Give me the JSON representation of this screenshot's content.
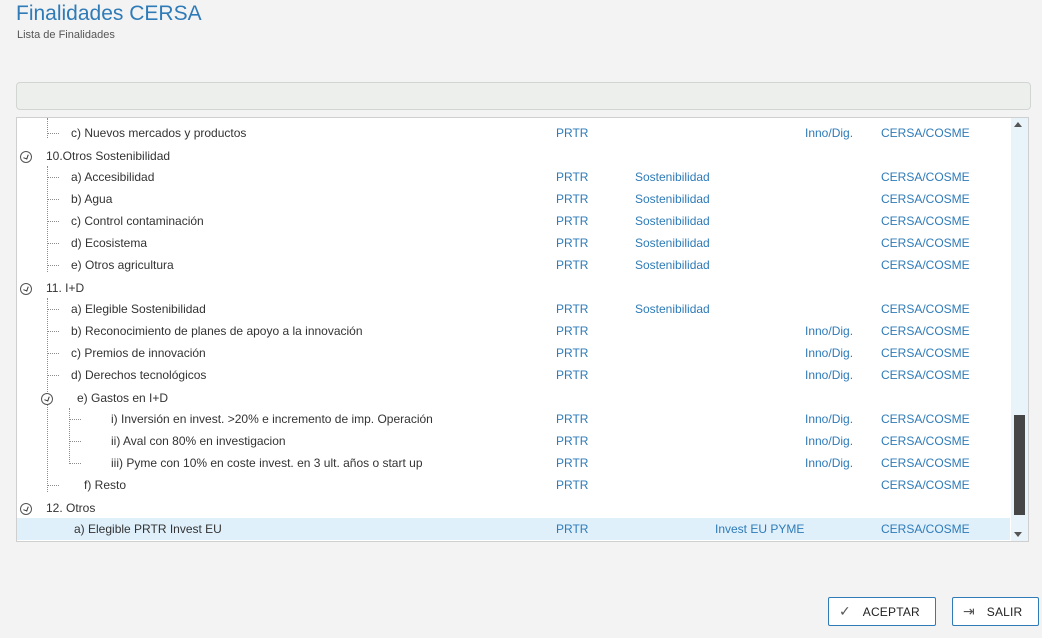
{
  "header": {
    "title": "Finalidades CERSA",
    "subtitle": "Lista de Finalidades"
  },
  "tree": {
    "rows": [
      {
        "label": "c) Nuevos mercados y productos",
        "prtr": "PRTR",
        "sost": "",
        "inno": "Inno/Dig.",
        "org": "CERSA/COSME"
      },
      {
        "label": "10.Otros Sostenibilidad",
        "prtr": "",
        "sost": "",
        "inno": "",
        "org": ""
      },
      {
        "label": "a) Accesibilidad",
        "prtr": "PRTR",
        "sost": "Sostenibilidad",
        "inno": "",
        "org": "CERSA/COSME"
      },
      {
        "label": "b) Agua",
        "prtr": "PRTR",
        "sost": "Sostenibilidad",
        "inno": "",
        "org": "CERSA/COSME"
      },
      {
        "label": "c) Control contaminación",
        "prtr": "PRTR",
        "sost": "Sostenibilidad",
        "inno": "",
        "org": "CERSA/COSME"
      },
      {
        "label": "d) Ecosistema",
        "prtr": "PRTR",
        "sost": "Sostenibilidad",
        "inno": "",
        "org": "CERSA/COSME"
      },
      {
        "label": "e) Otros agricultura",
        "prtr": "PRTR",
        "sost": "Sostenibilidad",
        "inno": "",
        "org": "CERSA/COSME"
      },
      {
        "label": "11. I+D",
        "prtr": "",
        "sost": "",
        "inno": "",
        "org": ""
      },
      {
        "label": "a) Elegible Sostenibilidad",
        "prtr": "PRTR",
        "sost": "Sostenibilidad",
        "inno": "",
        "org": "CERSA/COSME"
      },
      {
        "label": "b) Reconocimiento de planes de apoyo a la innovación",
        "prtr": "PRTR",
        "sost": "",
        "inno": "Inno/Dig.",
        "org": "CERSA/COSME"
      },
      {
        "label": "c) Premios de innovación",
        "prtr": "PRTR",
        "sost": "",
        "inno": "Inno/Dig.",
        "org": "CERSA/COSME"
      },
      {
        "label": "d) Derechos tecnológicos",
        "prtr": "PRTR",
        "sost": "",
        "inno": "Inno/Dig.",
        "org": "CERSA/COSME"
      },
      {
        "label": "e) Gastos en I+D",
        "prtr": "",
        "sost": "",
        "inno": "",
        "org": ""
      },
      {
        "label": "i)  Inversión en invest. >20% e incremento de imp. Operación",
        "prtr": "PRTR",
        "sost": "",
        "inno": "Inno/Dig.",
        "org": "CERSA/COSME"
      },
      {
        "label": "ii)  Aval con 80% en investigacion",
        "prtr": "PRTR",
        "sost": "",
        "inno": "Inno/Dig.",
        "org": "CERSA/COSME"
      },
      {
        "label": "iii)  Pyme con 10% en coste invest. en 3 ult. años o start up",
        "prtr": "PRTR",
        "sost": "",
        "inno": "Inno/Dig.",
        "org": "CERSA/COSME"
      },
      {
        "label": "f) Resto",
        "prtr": "PRTR",
        "sost": "",
        "inno": "",
        "org": "CERSA/COSME"
      },
      {
        "label": "12. Otros",
        "prtr": "",
        "sost": "",
        "inno": "",
        "org": ""
      },
      {
        "label": "a) Elegible PRTR Invest EU",
        "prtr": "PRTR",
        "sost": "Invest EU PYME",
        "inno": "",
        "org": "CERSA/COSME"
      }
    ]
  },
  "buttons": {
    "accept_label": "ACEPTAR",
    "exit_label": "SALIR"
  },
  "icons": {
    "accept": "check-icon",
    "exit": "exit-arrow-icon",
    "toggle": "collapse-toggle-icon"
  },
  "colors": {
    "accent": "#2e7bb8",
    "selected_row": "#dff0fb"
  }
}
